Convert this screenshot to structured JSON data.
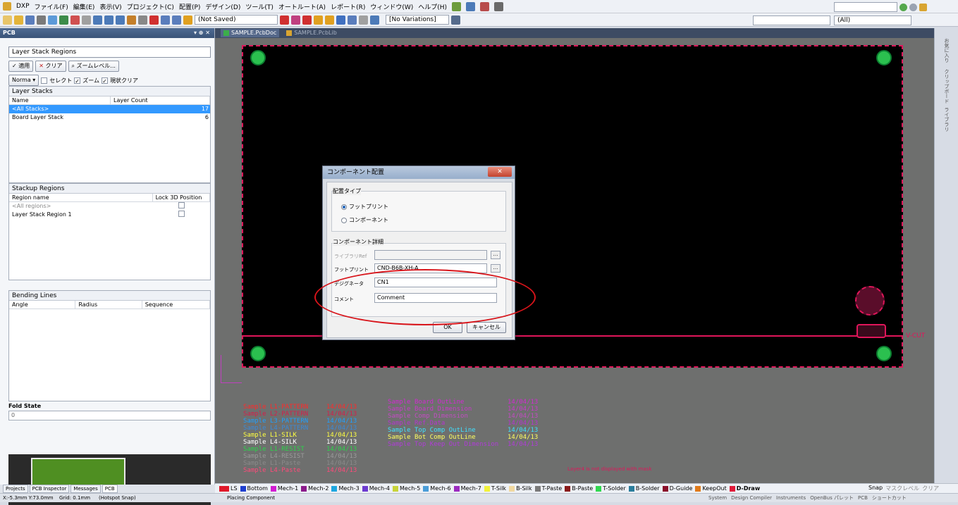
{
  "menu": [
    "DXP",
    "ファイル(F)",
    "編集(E)",
    "表示(V)",
    "プロジェクト(C)",
    "配置(P)",
    "デザイン(D)",
    "ツール(T)",
    "オートルート(A)",
    "レポート(R)",
    "ウィンドウ(W)",
    "ヘルプ(H)"
  ],
  "toolbar": {
    "save_state": "(Not Saved)",
    "variations": "[No Variations]",
    "filter_all": "(All)"
  },
  "panel": {
    "title": "PCB",
    "mode": "Layer Stack Regions",
    "buttons": {
      "apply": "適用",
      "clear": "クリア",
      "zoom": "ズームレベル..."
    },
    "filter": {
      "mode": "Norma",
      "select": "セレクト",
      "zoom": "ズーム",
      "clear_existing": "現状クリア"
    },
    "layer_stacks": {
      "title": "Layer Stacks",
      "col_name": "Name",
      "col_count": "Layer Count",
      "rows": [
        {
          "name": "<All Stacks>",
          "count": "17"
        },
        {
          "name": "Board Layer Stack",
          "count": "6"
        }
      ]
    },
    "stackup": {
      "title": "Stackup Regions",
      "col_name": "Region name",
      "col_lock": "Lock 3D Position",
      "rows": [
        {
          "name": "<All regions>"
        },
        {
          "name": "Layer Stack Region 1"
        }
      ]
    },
    "bending": {
      "title": "Bending Lines",
      "col_angle": "Angle",
      "col_radius": "Radius",
      "col_seq": "Sequence"
    },
    "fold": {
      "title": "Fold State",
      "value": "0"
    }
  },
  "bottom_tabs": [
    "Projects",
    "PCB Inspector",
    "Messages",
    "PCB"
  ],
  "doc_tabs": [
    {
      "label": "SAMPLE.PcbDoc"
    },
    {
      "label": "SAMPLE.PcbLib"
    }
  ],
  "dialog": {
    "title": "コンポーネント配置",
    "type_label": "配置タイプ",
    "opt_footprint": "フットプリント",
    "opt_component": "コンポーネント",
    "details_label": "コンポーネント詳細",
    "lib_ref_label": "ライブラリRef",
    "lib_ref_value": "",
    "footprint_label": "フットプリント",
    "footprint_value": "CND-B6B-XH-A",
    "designator_label": "デジグネータ",
    "designator_value": "CN1",
    "comment_label": "コメント",
    "comment_value": "Comment",
    "ok": "OK",
    "cancel": "キャンセル"
  },
  "legend_left": [
    {
      "c1": "Sample",
      "c2": "L1-PATTERN",
      "c3": "14/04/13",
      "color": "#ff2a2a"
    },
    {
      "c1": "Sample",
      "c2": "L2-PATTERN",
      "c3": "14/04/13",
      "color": "#d4204a"
    },
    {
      "c1": "Sample",
      "c2": "L3-PATTERN",
      "c3": "14/04/13",
      "color": "#1ea0ff"
    },
    {
      "c1": "Sample",
      "c2": "L4-PATTERN",
      "c3": "14/04/13",
      "color": "#3a8ad8"
    },
    {
      "c1": "Sample",
      "c2": "L1-SILK",
      "c3": "14/04/13",
      "color": "#ffff40"
    },
    {
      "c1": "Sample",
      "c2": "L4-SILK",
      "c3": "14/04/13",
      "color": "#ffffff"
    },
    {
      "c1": "Sample",
      "c2": "L1-RESIST",
      "c3": "14/04/13",
      "color": "#2bd44a"
    },
    {
      "c1": "Sample",
      "c2": "L4-RESIST",
      "c3": "14/04/13",
      "color": "#9a9a9a"
    },
    {
      "c1": "Sample",
      "c2": "L1-Paste",
      "c3": "14/04/13",
      "color": "#8a8a8a"
    },
    {
      "c1": "Sample",
      "c2": "L4-Paste",
      "c3": "14/04/13",
      "color": "#ff4a7a"
    }
  ],
  "legend_right": [
    {
      "c1": "Sample",
      "c2": "Board OutLine",
      "c3": "14/04/13",
      "color": "#d22ad2"
    },
    {
      "c1": "Sample",
      "c2": "Board Dimension",
      "c3": "14/04/13",
      "color": "#c93ac9"
    },
    {
      "c1": "Sample",
      "c2": "Comp Dimension",
      "c3": "14/04/13",
      "color": "#c24cc2"
    },
    {
      "c1": "Sample",
      "c2": "Ref.Data",
      "c3": "14/04/13",
      "color": "#b534d0"
    },
    {
      "c1": "Sample",
      "c2": "Top Comp OutLine",
      "c3": "14/04/13",
      "color": "#3fe0ff"
    },
    {
      "c1": "Sample",
      "c2": "Bot Comp OutLine",
      "c3": "14/04/13",
      "color": "#ffff60"
    },
    {
      "c1": "Sample",
      "c2": "Top Keep Out Dimension",
      "c3": "14/04/13",
      "color": "#b03cd8"
    }
  ],
  "canvas_note": "Layer4 is not displayed with mask",
  "vcut_label": "V-CUT",
  "side_labels": [
    "お気に入り",
    "クリップボード",
    "ライブラリ"
  ],
  "layers": [
    {
      "name": "LS",
      "color": "#e0192b"
    },
    {
      "name": "Bottom",
      "color": "#1f3fcf"
    },
    {
      "name": "Mech-1",
      "color": "#d21cd2"
    },
    {
      "name": "Mech-2",
      "color": "#8b1a8b"
    },
    {
      "name": "Mech-3",
      "color": "#1da7e0"
    },
    {
      "name": "Mech-4",
      "color": "#6c3bd0"
    },
    {
      "name": "Mech-5",
      "color": "#c8d33a"
    },
    {
      "name": "Mech-6",
      "color": "#4a9dd8"
    },
    {
      "name": "Mech-7",
      "color": "#9c2bc0"
    },
    {
      "name": "T-Silk",
      "color": "#f1f13a"
    },
    {
      "name": "B-Silk",
      "color": "#f0d8a0"
    },
    {
      "name": "T-Paste",
      "color": "#7a7a7a"
    },
    {
      "name": "B-Paste",
      "color": "#8a1a1a"
    },
    {
      "name": "T-Solder",
      "color": "#30d850"
    },
    {
      "name": "B-Solder",
      "color": "#2a7d9c"
    },
    {
      "name": "D-Guide",
      "color": "#8a0e2a"
    },
    {
      "name": "KeepOut",
      "color": "#e07a1a"
    },
    {
      "name": "D-Draw",
      "color": "#e01a3a"
    }
  ],
  "layerbar_right": {
    "snap_label": "Snap",
    "mask_label": "マスクレベル",
    "clear_label": "クリア"
  },
  "status": {
    "coords": "X:-5.3mm Y:73.0mm",
    "grid": "Grid: 0.1mm",
    "snap": "(Hotspot Snap)",
    "action": "Placing Component",
    "right": [
      "System",
      "Design Compiler",
      "Instruments",
      "OpenBus パレット",
      "PCB",
      "ショートカット"
    ]
  }
}
